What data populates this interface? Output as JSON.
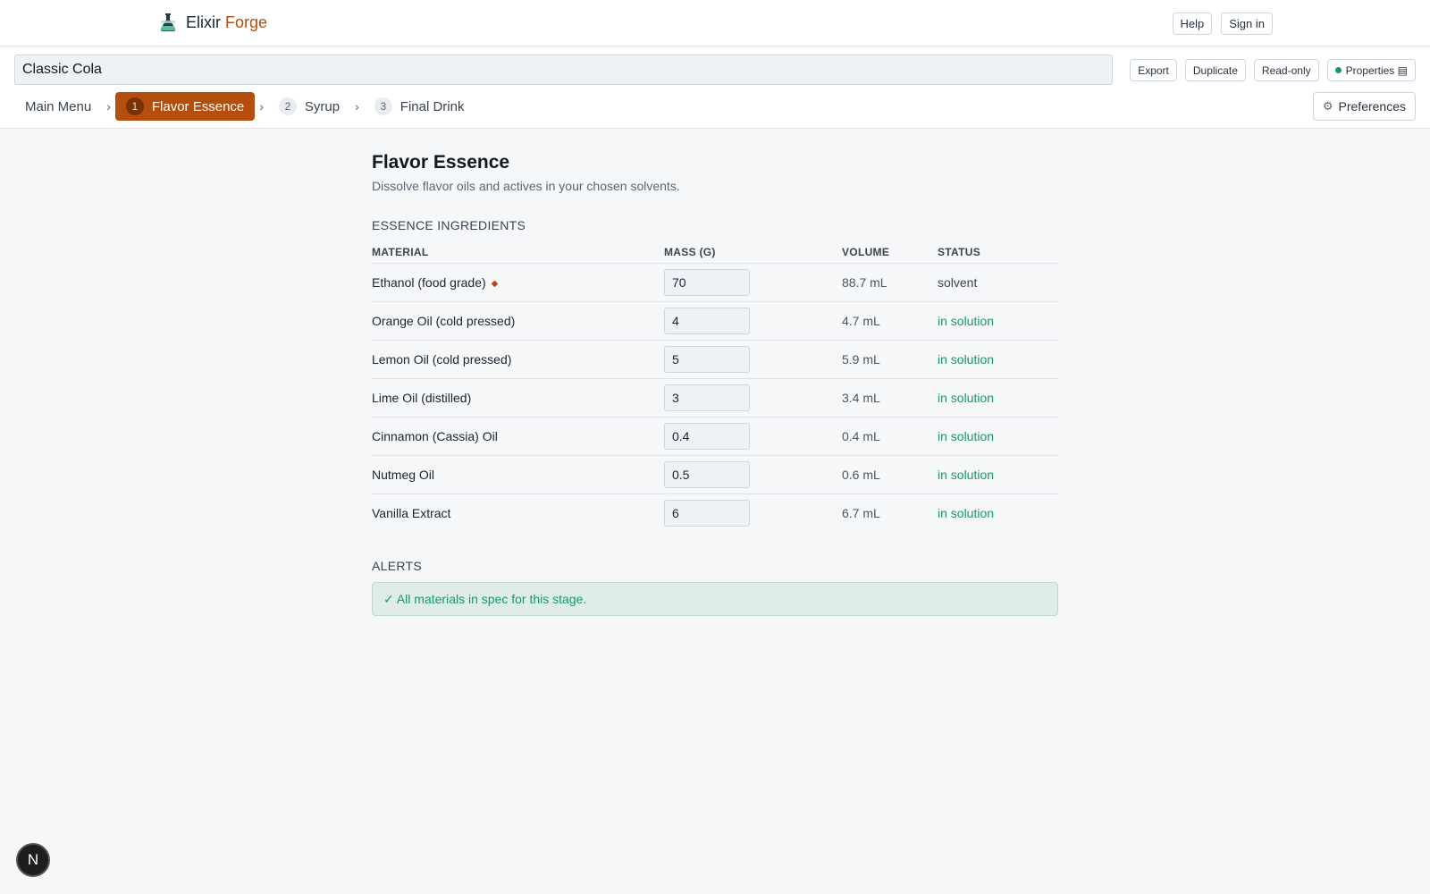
{
  "app": {
    "brand_primary": "Elixir",
    "brand_accent": "Forge",
    "help_label": "Help",
    "signin_label": "Sign in"
  },
  "document": {
    "title_value": "Classic Cola",
    "export_label": "Export",
    "duplicate_label": "Duplicate",
    "readonly_label": "Read-only",
    "properties_label": "Properties"
  },
  "steps": {
    "main_menu": "Main Menu",
    "items": [
      {
        "num": "1",
        "label": "Flavor Essence",
        "active": true
      },
      {
        "num": "2",
        "label": "Syrup",
        "active": false
      },
      {
        "num": "3",
        "label": "Final Drink",
        "active": false
      }
    ],
    "preferences_label": "Preferences"
  },
  "stage": {
    "title": "Flavor Essence",
    "subtitle": "Dissolve flavor oils and actives in your chosen solvents."
  },
  "ingredients": {
    "section_label": "ESSENCE INGREDIENTS",
    "columns": [
      "MATERIAL",
      "MASS (G)",
      "VOLUME",
      "STATUS"
    ],
    "rows": [
      {
        "material": "Ethanol (food grade)",
        "mass": "70",
        "volume": "88.7 mL",
        "status": "solvent",
        "flag": "◆"
      },
      {
        "material": "Orange Oil (cold pressed)",
        "mass": "4",
        "volume": "4.7 mL",
        "status": "in solution"
      },
      {
        "material": "Lemon Oil (cold pressed)",
        "mass": "5",
        "volume": "5.9 mL",
        "status": "in solution"
      },
      {
        "material": "Lime Oil (distilled)",
        "mass": "3",
        "volume": "3.4 mL",
        "status": "in solution"
      },
      {
        "material": "Cinnamon (Cassia) Oil",
        "mass": "0.4",
        "volume": "0.4 mL",
        "status": "in solution"
      },
      {
        "material": "Nutmeg Oil",
        "mass": "0.5",
        "volume": "0.6 mL",
        "status": "in solution"
      },
      {
        "material": "Vanilla Extract",
        "mass": "6",
        "volume": "6.7 mL",
        "status": "in solution"
      }
    ]
  },
  "alerts": {
    "section_label": "ALERTS",
    "message": "✓ All materials in spec for this stage."
  },
  "fab": {
    "label": "N"
  },
  "colors": {
    "accent": "#b54d0c",
    "success": "#16996a",
    "background": "#f5f7f9"
  }
}
